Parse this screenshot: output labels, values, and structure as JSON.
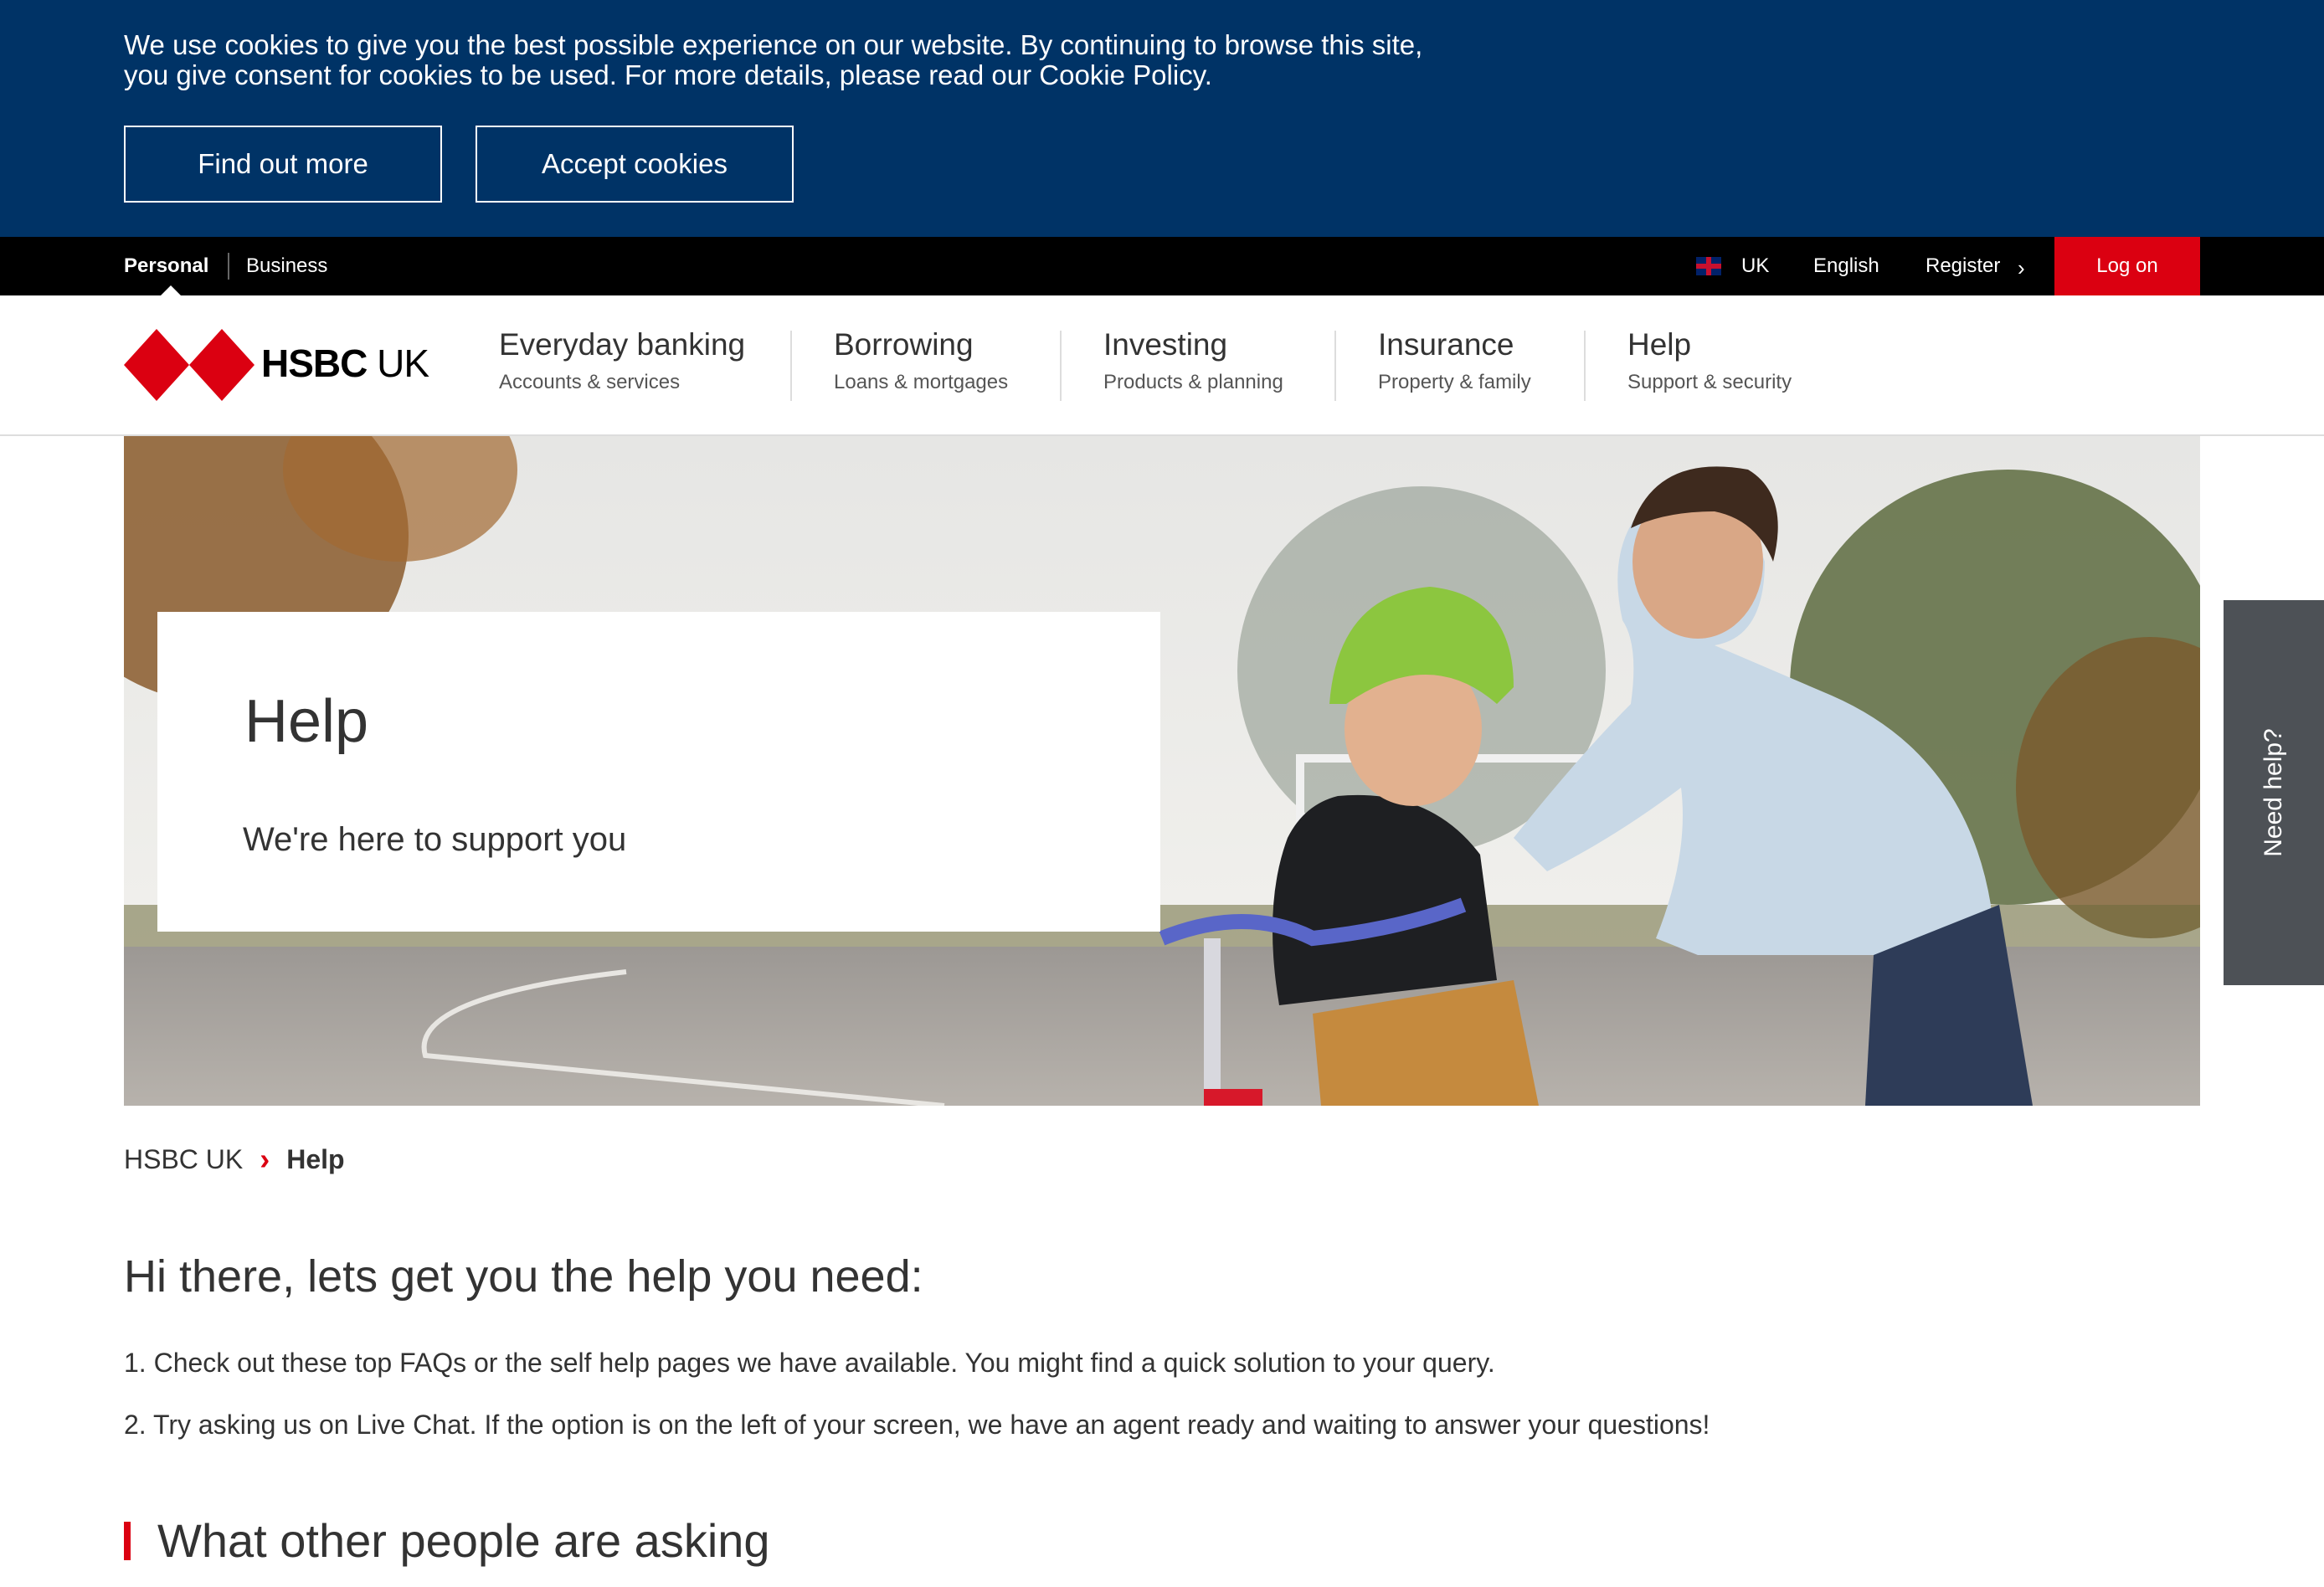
{
  "cookie_banner": {
    "line1": "We use cookies to give you the best possible experience on our website. By continuing to browse this site,",
    "line2": "you give consent for cookies to be used. For more details, please read our Cookie Policy.",
    "find_out_more": "Find out more",
    "accept": "Accept cookies"
  },
  "topbar": {
    "personal": "Personal",
    "business": "Business",
    "country": "UK",
    "language": "English",
    "register": "Register",
    "logon": "Log on"
  },
  "logo": {
    "bold": "HSBC",
    "suffix": " UK"
  },
  "nav": [
    {
      "title": "Everyday banking",
      "sub": "Accounts & services"
    },
    {
      "title": "Borrowing",
      "sub": "Loans & mortgages"
    },
    {
      "title": "Investing",
      "sub": "Products & planning"
    },
    {
      "title": "Insurance",
      "sub": "Property & family"
    },
    {
      "title": "Help",
      "sub": "Support & security"
    }
  ],
  "hero": {
    "title": "Help",
    "subtitle": "We're here to support you"
  },
  "need_help": "Need help?",
  "breadcrumb": {
    "home": "HSBC UK",
    "current": "Help"
  },
  "content": {
    "intro": "Hi there, lets get you the help you need:",
    "step1": "1. Check out these top FAQs or the self help pages we have available. You might find a quick solution to your query.",
    "step2": "2. Try asking us on Live Chat. If the option is on the left of your screen, we have an agent ready and waiting to answer your questions!",
    "section_title": "What other people are asking"
  },
  "colors": {
    "brand_red": "#db0011",
    "banner_blue": "#003366",
    "topbar": "#000000"
  },
  "icons": {
    "flag": "uk-flag-icon",
    "chevron": "chevron-right-icon",
    "logo": "hsbc-hexagon-logo"
  }
}
